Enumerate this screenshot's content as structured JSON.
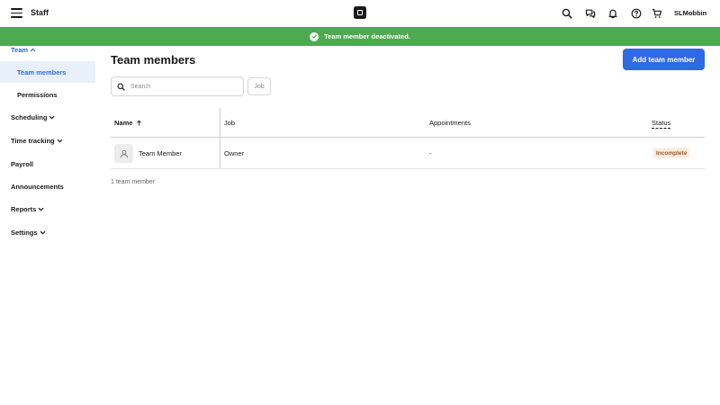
{
  "header": {
    "app_title": "Staff",
    "user_name": "SLMobbin",
    "icons": [
      "menu-icon",
      "square-logo-icon",
      "search-icon",
      "messages-icon",
      "bell-icon",
      "help-icon",
      "cart-icon"
    ]
  },
  "toast": {
    "message": "Team member deactivated.",
    "color": "#4daa50"
  },
  "sidebar": {
    "groups": [
      {
        "label": "Team",
        "expanded": true,
        "items": [
          {
            "label": "Team members",
            "selected": true
          },
          {
            "label": "Permissions",
            "selected": false
          }
        ]
      },
      {
        "label": "Scheduling",
        "expanded": false
      },
      {
        "label": "Time tracking",
        "expanded": false
      },
      {
        "label": "Payroll"
      },
      {
        "label": "Announcements"
      },
      {
        "label": "Reports",
        "expanded": false
      },
      {
        "label": "Settings",
        "expanded": false
      }
    ]
  },
  "main": {
    "title": "Team members",
    "add_button": "Add team member",
    "search_placeholder": "Search",
    "job_filter": "Job",
    "table": {
      "columns": [
        "Name",
        "Job",
        "Appointments",
        "Status"
      ],
      "sort_column": "Name",
      "rows": [
        {
          "name": "Team Member",
          "job": "Owner",
          "appointments": "-",
          "status": "Incomplete"
        }
      ]
    },
    "count_text": "1 team member"
  },
  "colors": {
    "accent": "#2d6ae3",
    "selected_bg": "#e8f0fc",
    "badge_bg": "#fdeee2",
    "badge_text": "#a0501c"
  }
}
